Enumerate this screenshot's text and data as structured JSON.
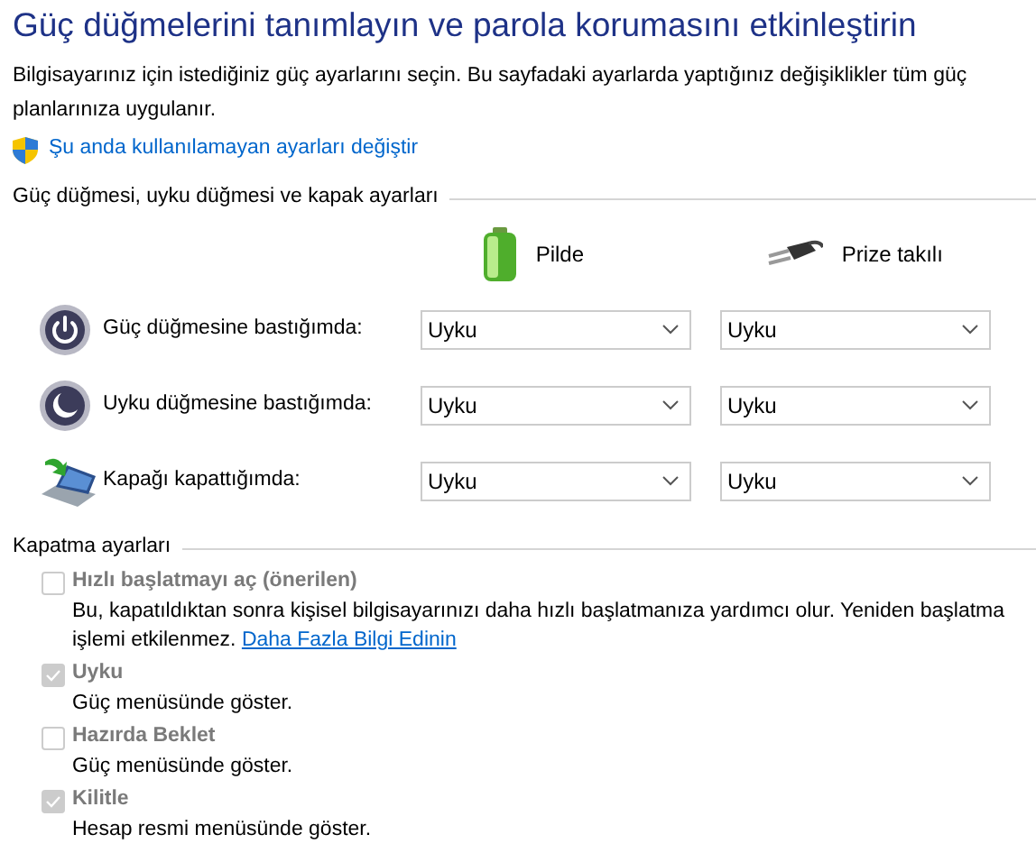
{
  "title": "Güç düğmelerini tanımlayın ve parola korumasını etkinleştirin",
  "description": "Bilgisayarınız için istediğiniz güç ayarlarını seçin. Bu sayfadaki ayarlarda yaptığınız değişiklikler tüm güç planlarınıza uygulanır.",
  "admin_link": "Şu anda kullanılamayan ayarları değiştir",
  "buttons_section": {
    "heading": "Güç düğmesi, uyku düğmesi ve kapak ayarları",
    "columns": [
      {
        "kind": "battery",
        "label": "Pilde"
      },
      {
        "kind": "plug",
        "label": "Prize takılı"
      }
    ],
    "rows": [
      {
        "kind": "power",
        "label": "Güç düğmesine bastığımda:",
        "values": [
          "Uyku",
          "Uyku"
        ]
      },
      {
        "kind": "sleep",
        "label": "Uyku düğmesine bastığımda:",
        "values": [
          "Uyku",
          "Uyku"
        ]
      },
      {
        "kind": "lid",
        "label": "Kapağı kapattığımda:",
        "values": [
          "Uyku",
          "Uyku"
        ]
      }
    ]
  },
  "shutdown_section": {
    "heading": "Kapatma ayarları",
    "options": [
      {
        "label": "Hızlı başlatmayı aç (önerilen)",
        "checked": false,
        "disabled": true,
        "description": "Bu, kapatıldıktan sonra kişisel bilgisayarınızı daha hızlı başlatmanıza yardımcı olur. Yeniden başlatma işlemi etkilenmez.",
        "link": "Daha Fazla Bilgi Edinin"
      },
      {
        "label": "Uyku",
        "checked": true,
        "disabled": true,
        "description": "Güç menüsünde göster."
      },
      {
        "label": "Hazırda Beklet",
        "checked": false,
        "disabled": true,
        "description": "Güç menüsünde göster."
      },
      {
        "label": "Kilitle",
        "checked": true,
        "disabled": true,
        "description": "Hesap resmi menüsünde göster."
      }
    ]
  }
}
